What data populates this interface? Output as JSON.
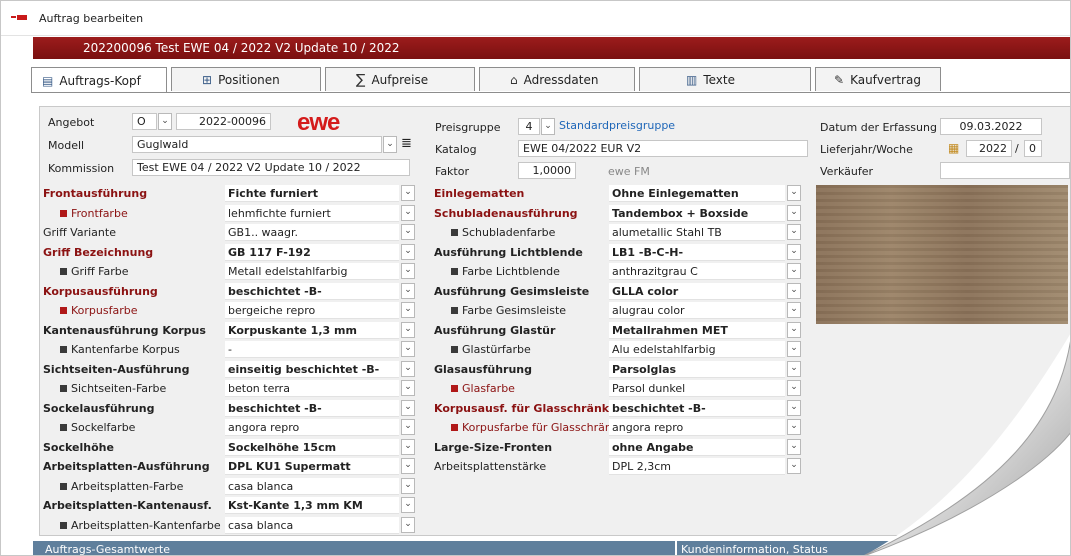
{
  "window": {
    "title": "Auftrag bearbeiten"
  },
  "header": {
    "order_line": "202200096  Test EWE 04 / 2022 V2 Update 10 / 2022"
  },
  "tabs": [
    {
      "label": "Auftrags-Kopf",
      "icon": "table-icon"
    },
    {
      "label": "Positionen",
      "icon": "tree-icon"
    },
    {
      "label": "Aufpreise",
      "icon": "sum-icon"
    },
    {
      "label": "Adressdaten",
      "icon": "house-icon"
    },
    {
      "label": "Texte",
      "icon": "text-icon"
    },
    {
      "label": "Kaufvertrag",
      "icon": "pen-icon"
    }
  ],
  "head": {
    "angebot_label": "Angebot",
    "angebot_type": "O",
    "angebot_number": "2022-00096",
    "logo": "ewe",
    "modell_label": "Modell",
    "modell_value": "Guglwald",
    "kommission_label": "Kommission",
    "kommission_value": "Test EWE 04 / 2022 V2 Update 10 / 2022",
    "preisgruppe_label": "Preisgruppe",
    "preisgruppe_value": "4",
    "preisgruppe_name": "Standardpreisgruppe",
    "katalog_label": "Katalog",
    "katalog_value": "EWE 04/2022 EUR V2",
    "faktor_label": "Faktor",
    "faktor_value": "1,0000",
    "faktor_note": "ewe FM",
    "datum_label": "Datum der Erfassung",
    "datum_value": "09.03.2022",
    "lieferjahr_label": "Lieferjahr/Woche",
    "lieferjahr_value": "2022",
    "lieferjahr_sep": "/",
    "lieferwoche_value": "0",
    "verkaeufer_label": "Verkäufer"
  },
  "left_rows": [
    {
      "label": "Frontausführung",
      "value": "Fichte furniert",
      "style": "red-bold"
    },
    {
      "label": "Frontfarbe",
      "value": "lehmfichte furniert",
      "style": "red-sub"
    },
    {
      "label": "Griff Variante",
      "value": "GB1.. waagr.",
      "style": "plain"
    },
    {
      "label": "Griff Bezeichnung",
      "value": "GB 117 F-192",
      "style": "red-bold"
    },
    {
      "label": "Griff Farbe",
      "value": "Metall edelstahlfarbig",
      "style": "sub"
    },
    {
      "label": "Korpusausführung",
      "value": "beschichtet -B-",
      "style": "red-bold"
    },
    {
      "label": "Korpusfarbe",
      "value": "bergeiche repro",
      "style": "red-sub"
    },
    {
      "label": "Kantenausführung Korpus",
      "value": "Korpuskante 1,3 mm",
      "style": "bold"
    },
    {
      "label": "Kantenfarbe Korpus",
      "value": "-",
      "style": "sub"
    },
    {
      "label": "Sichtseiten-Ausführung",
      "value": "einseitig beschichtet -B-",
      "style": "bold"
    },
    {
      "label": "Sichtseiten-Farbe",
      "value": "beton terra",
      "style": "sub"
    },
    {
      "label": "Sockelausführung",
      "value": "beschichtet -B-",
      "style": "bold"
    },
    {
      "label": "Sockelfarbe",
      "value": "angora repro",
      "style": "sub"
    },
    {
      "label": "Sockelhöhe",
      "value": "Sockelhöhe 15cm",
      "style": "bold"
    },
    {
      "label": "Arbeitsplatten-Ausführung",
      "value": "DPL KU1 Supermatt",
      "style": "bold"
    },
    {
      "label": "Arbeitsplatten-Farbe",
      "value": "casa blanca",
      "style": "sub"
    },
    {
      "label": "Arbeitsplatten-Kantenausf.",
      "value": "Kst-Kante 1,3 mm KM",
      "style": "bold"
    },
    {
      "label": "Arbeitsplatten-Kantenfarbe",
      "value": "casa blanca",
      "style": "sub"
    }
  ],
  "right_rows": [
    {
      "label": "Einlegematten",
      "value": "Ohne Einlegematten",
      "style": "red-bold"
    },
    {
      "label": "Schubladenausführung",
      "value": "Tandembox + Boxside",
      "style": "red-bold"
    },
    {
      "label": "Schubladenfarbe",
      "value": "alumetallic Stahl TB",
      "style": "sub"
    },
    {
      "label": "Ausführung Lichtblende",
      "value": "LB1 -B-C-H-",
      "style": "bold"
    },
    {
      "label": "Farbe Lichtblende",
      "value": "anthrazitgrau C",
      "style": "sub"
    },
    {
      "label": "Ausführung Gesimsleiste",
      "value": "GLLA color",
      "style": "bold"
    },
    {
      "label": "Farbe Gesimsleiste",
      "value": "alugrau color",
      "style": "sub"
    },
    {
      "label": "Ausführung Glastür",
      "value": "Metallrahmen MET",
      "style": "bold"
    },
    {
      "label": "Glastürfarbe",
      "value": "Alu edelstahlfarbig",
      "style": "sub"
    },
    {
      "label": "Glasausführung",
      "value": "Parsolglas",
      "style": "bold"
    },
    {
      "label": "Glasfarbe",
      "value": "Parsol dunkel",
      "style": "red-sub"
    },
    {
      "label": "Korpusausf. für Glasschränke",
      "value": "beschichtet -B-",
      "style": "red-bold"
    },
    {
      "label": "Korpusfarbe für Glasschränke",
      "value": "angora repro",
      "style": "red-sub"
    },
    {
      "label": "Large-Size-Fronten",
      "value": "ohne Angabe",
      "style": "bold"
    },
    {
      "label": "Arbeitsplattenstärke",
      "value": "DPL 2,3cm",
      "style": "plain"
    }
  ],
  "footer": {
    "left": "Auftrags-Gesamtwerte",
    "right": "Kundeninformation, Status"
  },
  "colors": {
    "brand_red": "#d41b1b",
    "header_red": "#8a1414",
    "label_red": "#8b1212",
    "footer_blue": "#5f7f9c"
  }
}
